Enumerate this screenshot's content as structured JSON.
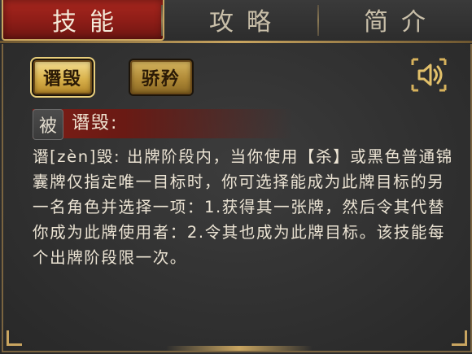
{
  "tabs": [
    {
      "label": "技能",
      "active": true
    },
    {
      "label": "攻略",
      "active": false
    },
    {
      "label": "简介",
      "active": false
    }
  ],
  "skill_buttons": [
    {
      "label": "谮毁",
      "selected": true
    },
    {
      "label": "骄矜",
      "selected": false
    }
  ],
  "sound_button": {
    "icon": "speaker-icon"
  },
  "skill_detail": {
    "badge": "被",
    "name": "谮毁:",
    "description": "谮[zèn]毁: 出牌阶段内，当你使用【杀】或黑色普通锦囊牌仅指定唯一目标时，你可选择能成为此牌目标的另一名角色并选择一项：1.获得其一张牌，然后令其代替你成为此牌使用者：2.令其也成为此牌目标。该技能每个出牌阶段限一次。"
  },
  "colors": {
    "active_tab": "#8d1d17",
    "gold_border": "#c9a560",
    "panel_bg": "#2e2e2e",
    "text": "#ece4d4"
  }
}
